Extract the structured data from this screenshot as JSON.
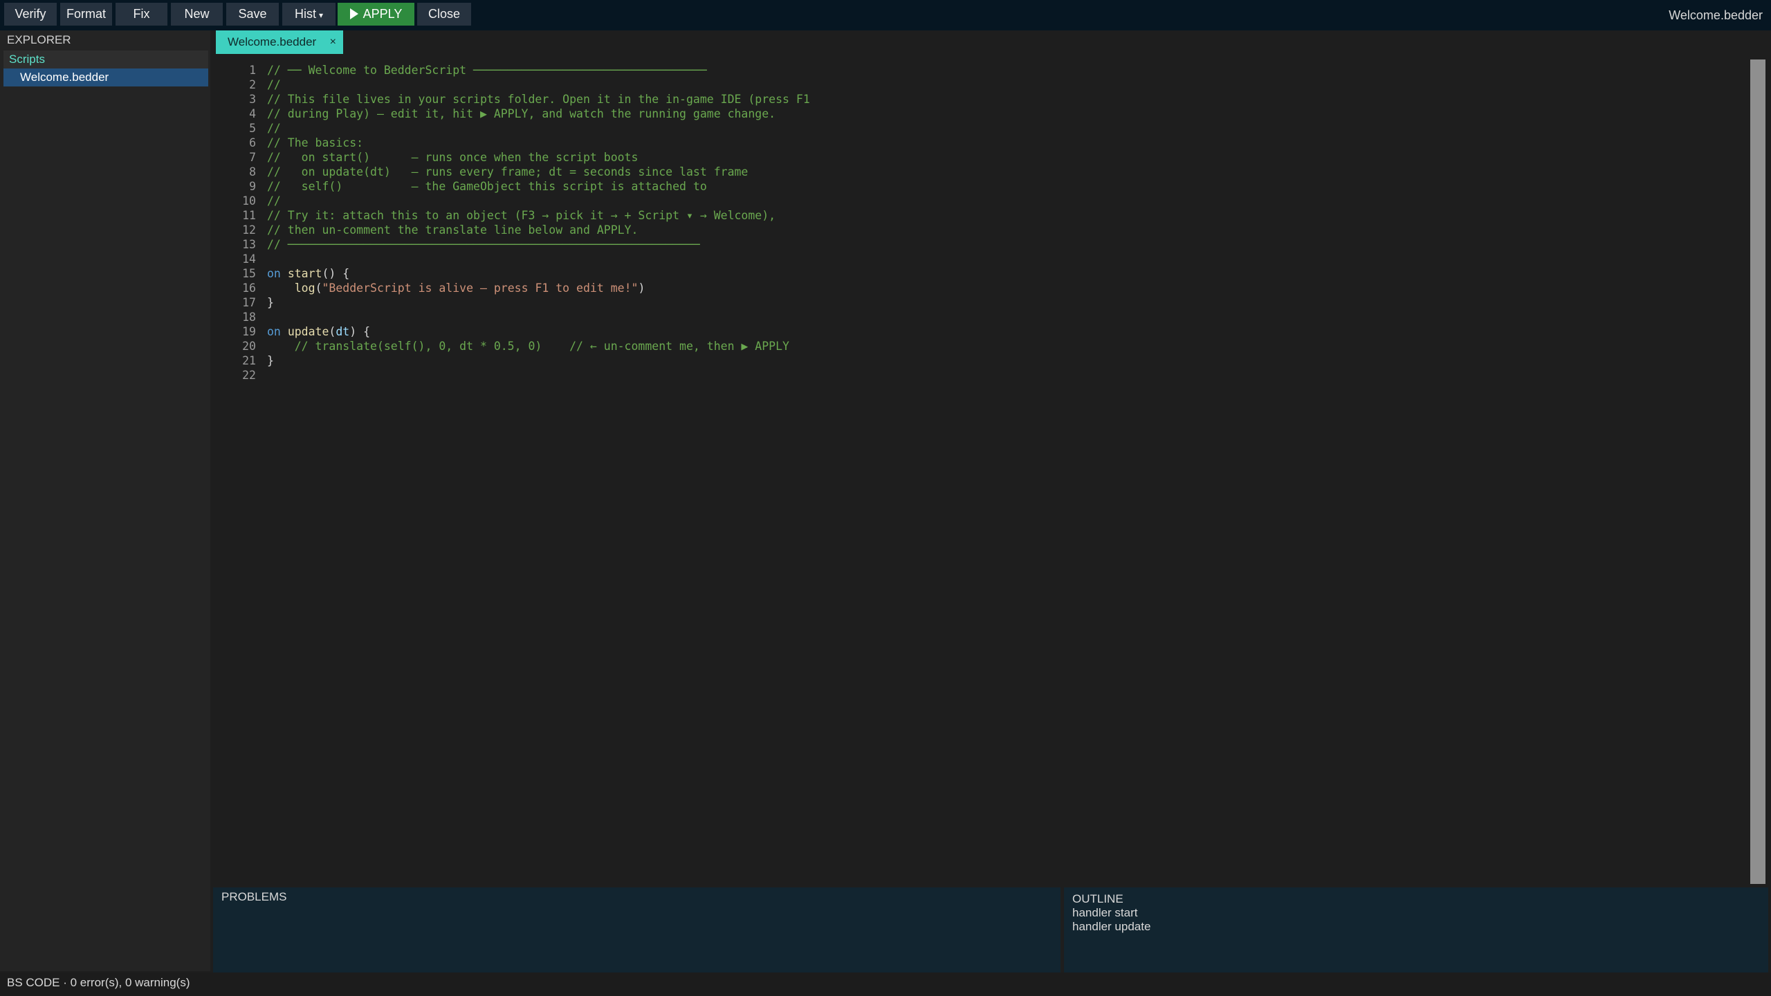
{
  "toolbar": {
    "buttons": [
      {
        "label": "Verify"
      },
      {
        "label": "Format"
      },
      {
        "label": "Fix"
      },
      {
        "label": "New"
      },
      {
        "label": "Save"
      },
      {
        "label": "Hist",
        "caret": "▾"
      },
      {
        "label": "APPLY",
        "icon": "play-icon",
        "accent": "#2e8b3e"
      },
      {
        "label": "Close"
      }
    ],
    "window_title": "Welcome.bedder"
  },
  "explorer": {
    "title": "EXPLORER",
    "folder": "Scripts",
    "files": [
      "Welcome.bedder"
    ]
  },
  "tabs": [
    {
      "label": "Welcome.bedder",
      "close": "×",
      "accent": "#3ed0bf"
    }
  ],
  "editor": {
    "lines": [
      [
        {
          "t": "// ── Welcome to BedderScript ──────────────────────────────────",
          "c": "cm"
        }
      ],
      [
        {
          "t": "//",
          "c": "cm"
        }
      ],
      [
        {
          "t": "// This file lives in your scripts folder. Open it in the in-game IDE (press F1",
          "c": "cm"
        }
      ],
      [
        {
          "t": "// during Play) — edit it, hit ▶ APPLY, and watch the running game change.",
          "c": "cm"
        }
      ],
      [
        {
          "t": "//",
          "c": "cm"
        }
      ],
      [
        {
          "t": "// The basics:",
          "c": "cm"
        }
      ],
      [
        {
          "t": "//   on start()      — runs once when the script boots",
          "c": "cm"
        }
      ],
      [
        {
          "t": "//   on update(dt)   — runs every frame; dt = seconds since last frame",
          "c": "cm"
        }
      ],
      [
        {
          "t": "//   self()          — the GameObject this script is attached to",
          "c": "cm"
        }
      ],
      [
        {
          "t": "//",
          "c": "cm"
        }
      ],
      [
        {
          "t": "// Try it: attach this to an object (F3 → pick it → + Script ▾ → Welcome),",
          "c": "cm"
        }
      ],
      [
        {
          "t": "// then un-comment the translate line below and APPLY.",
          "c": "cm"
        }
      ],
      [
        {
          "t": "// ────────────────────────────────────────────────────────────",
          "c": "cm"
        }
      ],
      [],
      [
        {
          "t": "on",
          "c": "kw"
        },
        {
          "t": " ",
          "c": "pu"
        },
        {
          "t": "start",
          "c": "fn"
        },
        {
          "t": "() {",
          "c": "pu"
        }
      ],
      [
        {
          "t": "    ",
          "c": "pu"
        },
        {
          "t": "log",
          "c": "fn"
        },
        {
          "t": "(",
          "c": "pu"
        },
        {
          "t": "\"BedderScript is alive — press F1 to edit me!\"",
          "c": "st"
        },
        {
          "t": ")",
          "c": "pu"
        }
      ],
      [
        {
          "t": "}",
          "c": "pu"
        }
      ],
      [],
      [
        {
          "t": "on",
          "c": "kw"
        },
        {
          "t": " ",
          "c": "pu"
        },
        {
          "t": "update",
          "c": "fn"
        },
        {
          "t": "(",
          "c": "pu"
        },
        {
          "t": "dt",
          "c": "pr"
        },
        {
          "t": ") {",
          "c": "pu"
        }
      ],
      [
        {
          "t": "    // translate(self(), 0, dt * 0.5, 0)    // ← un-comment me, then ▶ APPLY",
          "c": "cm"
        }
      ],
      [
        {
          "t": "}",
          "c": "pu"
        }
      ],
      []
    ]
  },
  "problems": {
    "title": "PROBLEMS",
    "items": []
  },
  "outline": {
    "title": "OUTLINE",
    "items": [
      "handler start",
      "handler update"
    ]
  },
  "status": {
    "text": "BS CODE · 0 error(s), 0 warning(s)"
  }
}
